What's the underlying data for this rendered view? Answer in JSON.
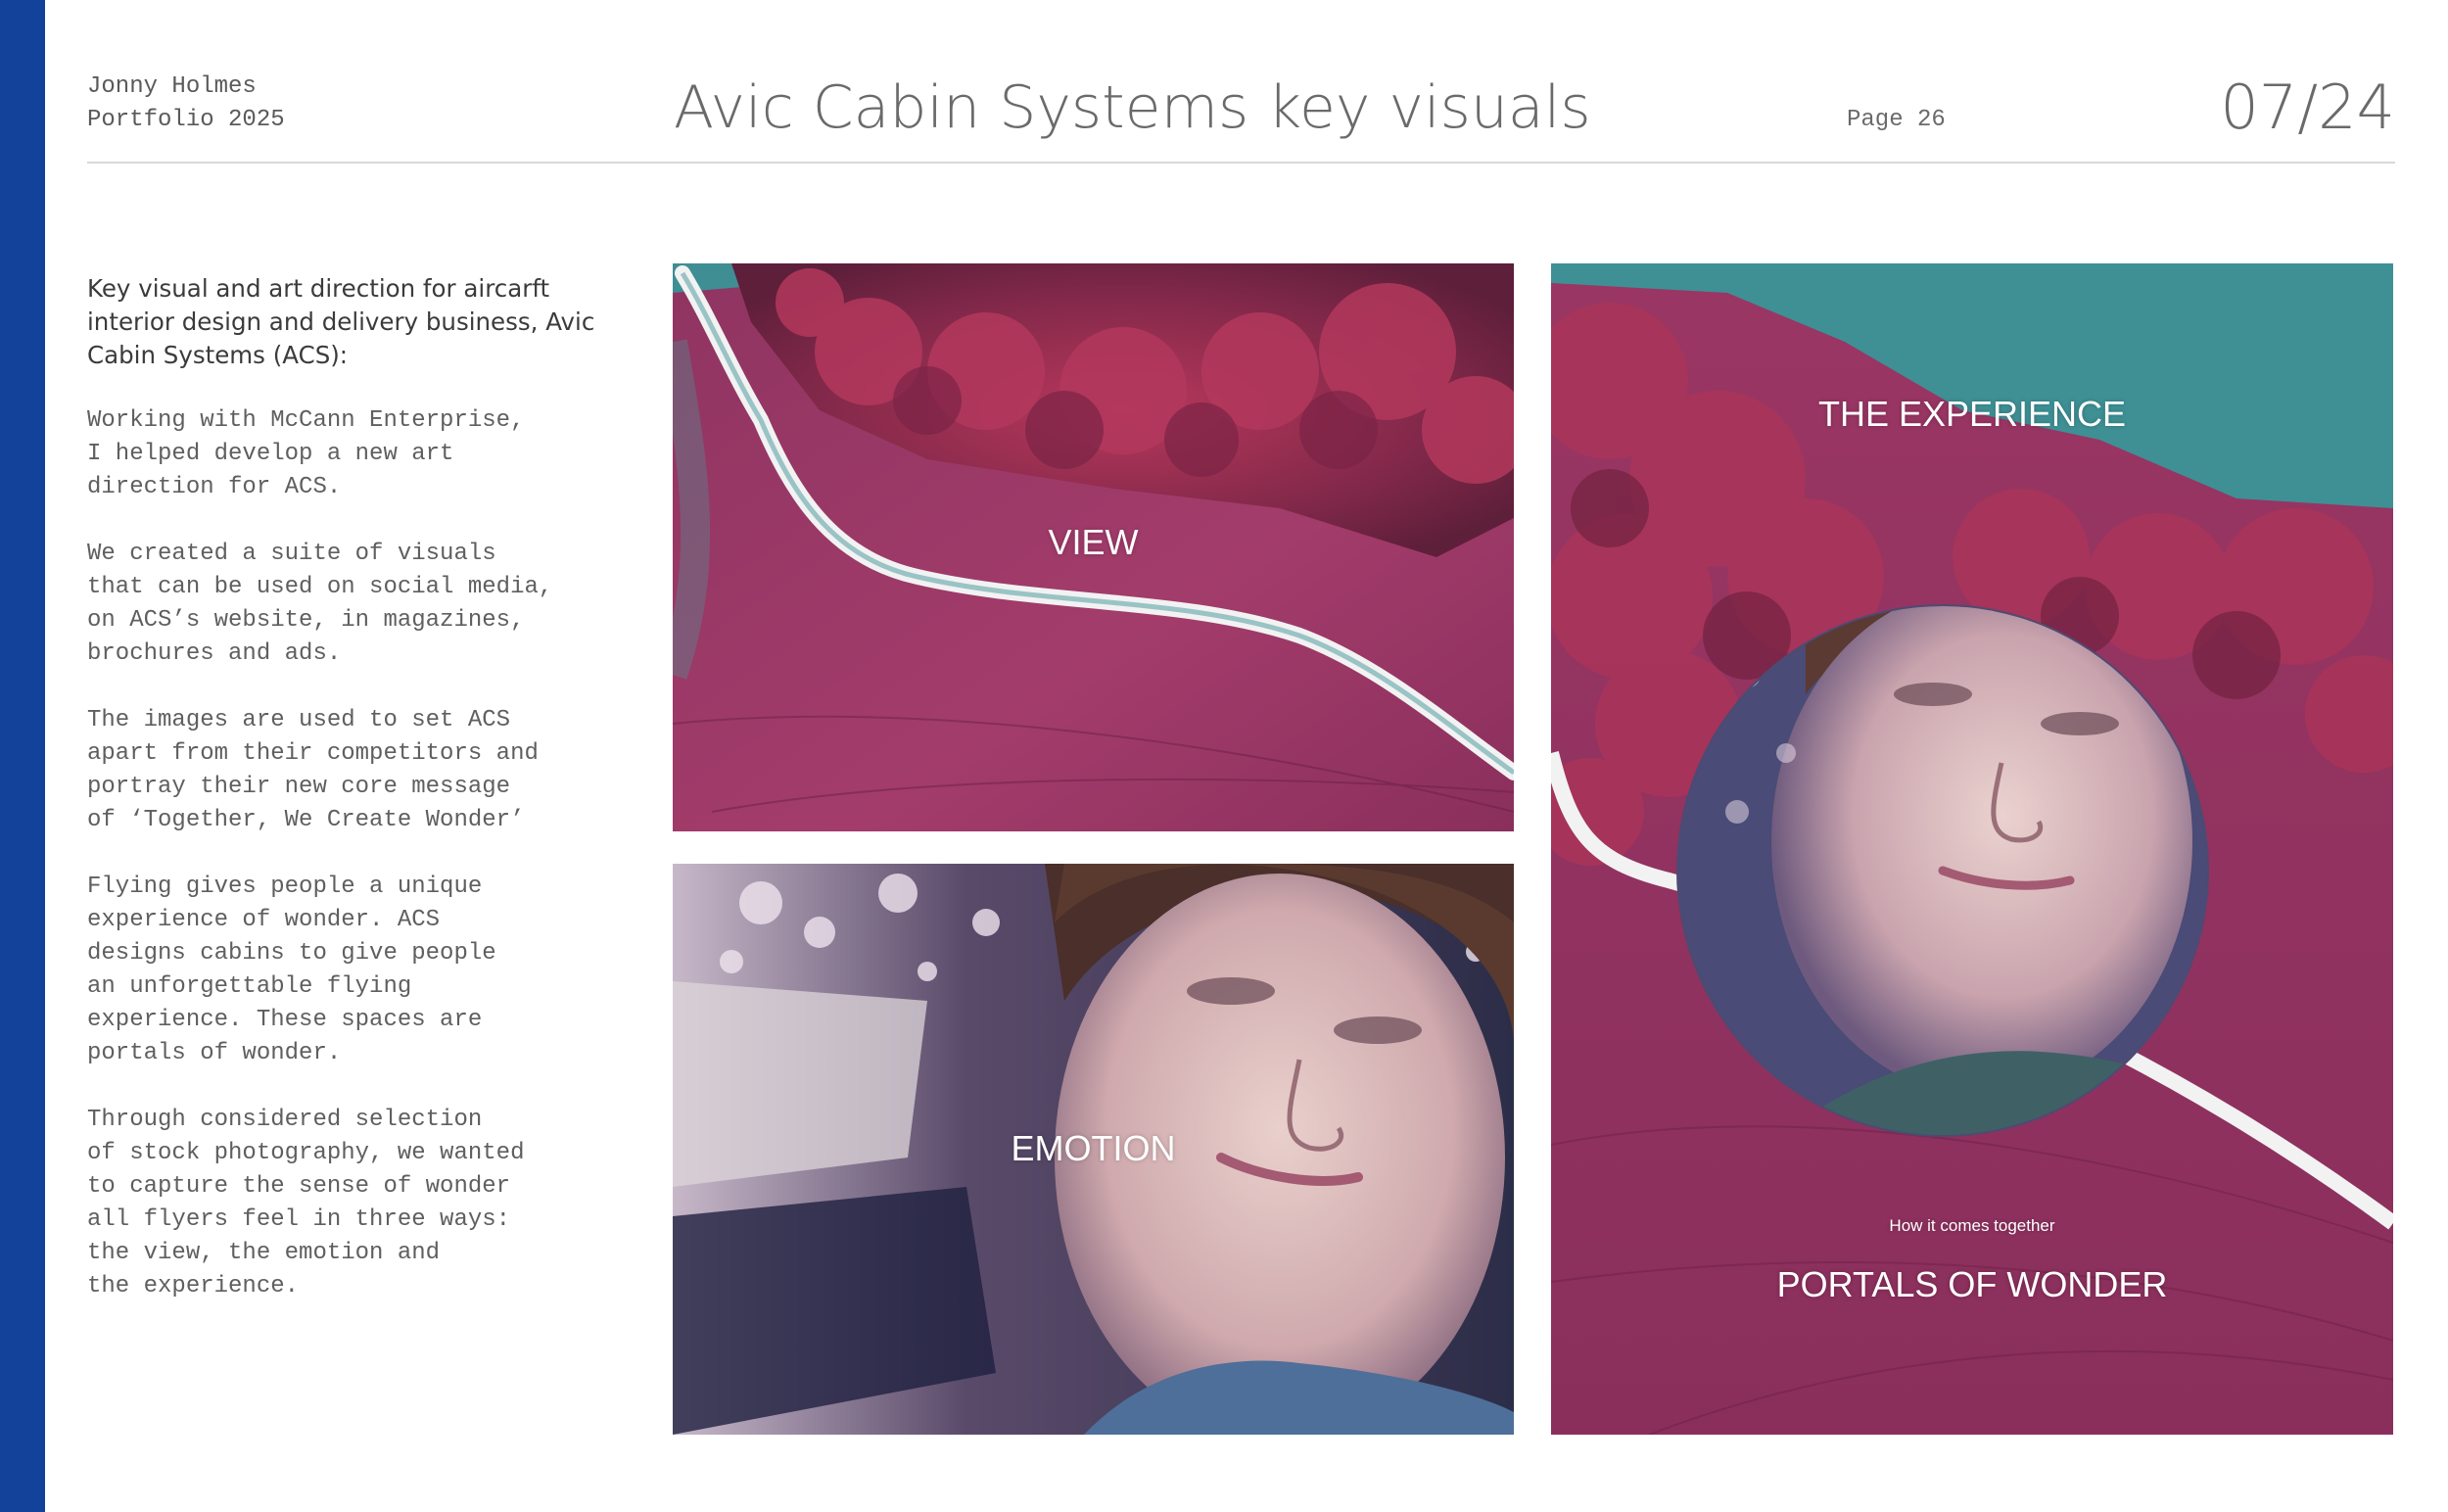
{
  "header": {
    "author_name": "Jonny Holmes",
    "author_sub": "Portfolio 2025",
    "title": "Avic Cabin Systems key visuals",
    "page_label": "Page 26",
    "page_count": "07/24"
  },
  "body": {
    "intro": "Key visual and art direction for aircarft interior design and delivery business, Avic Cabin Systems (ACS):",
    "paragraphs": [
      "Working with McCann Enterprise,\nI helped develop a new art\ndirection for ACS.",
      "We created a suite of visuals\nthat can be used on social media,\non ACS’s website, in magazines,\nbrochures and ads.",
      "The images are used to set ACS\napart from their competitors and\nportray their new core message\nof ‘Together, We Create Wonder’",
      "Flying gives people a unique\nexperience of wonder. ACS\ndesigns cabins to give people\nan unforgettable flying\nexperience. These spaces are\nportals of wonder.",
      "Through considered selection\nof stock photography, we wanted\nto capture the sense of wonder\nall flyers feel in three ways:\nthe view, the emotion and\nthe experience."
    ]
  },
  "visuals": {
    "view_label": "VIEW",
    "emotion_label": "EMOTION",
    "experience_label": "THE EXPERIENCE",
    "tagline": "How it comes together",
    "portals_label": "PORTALS OF WONDER"
  },
  "colors": {
    "accent_bar": "#12429a",
    "field_magenta": "#a43a6a",
    "field_teal": "#3f8f92",
    "tree_red": "#9a2f52"
  }
}
